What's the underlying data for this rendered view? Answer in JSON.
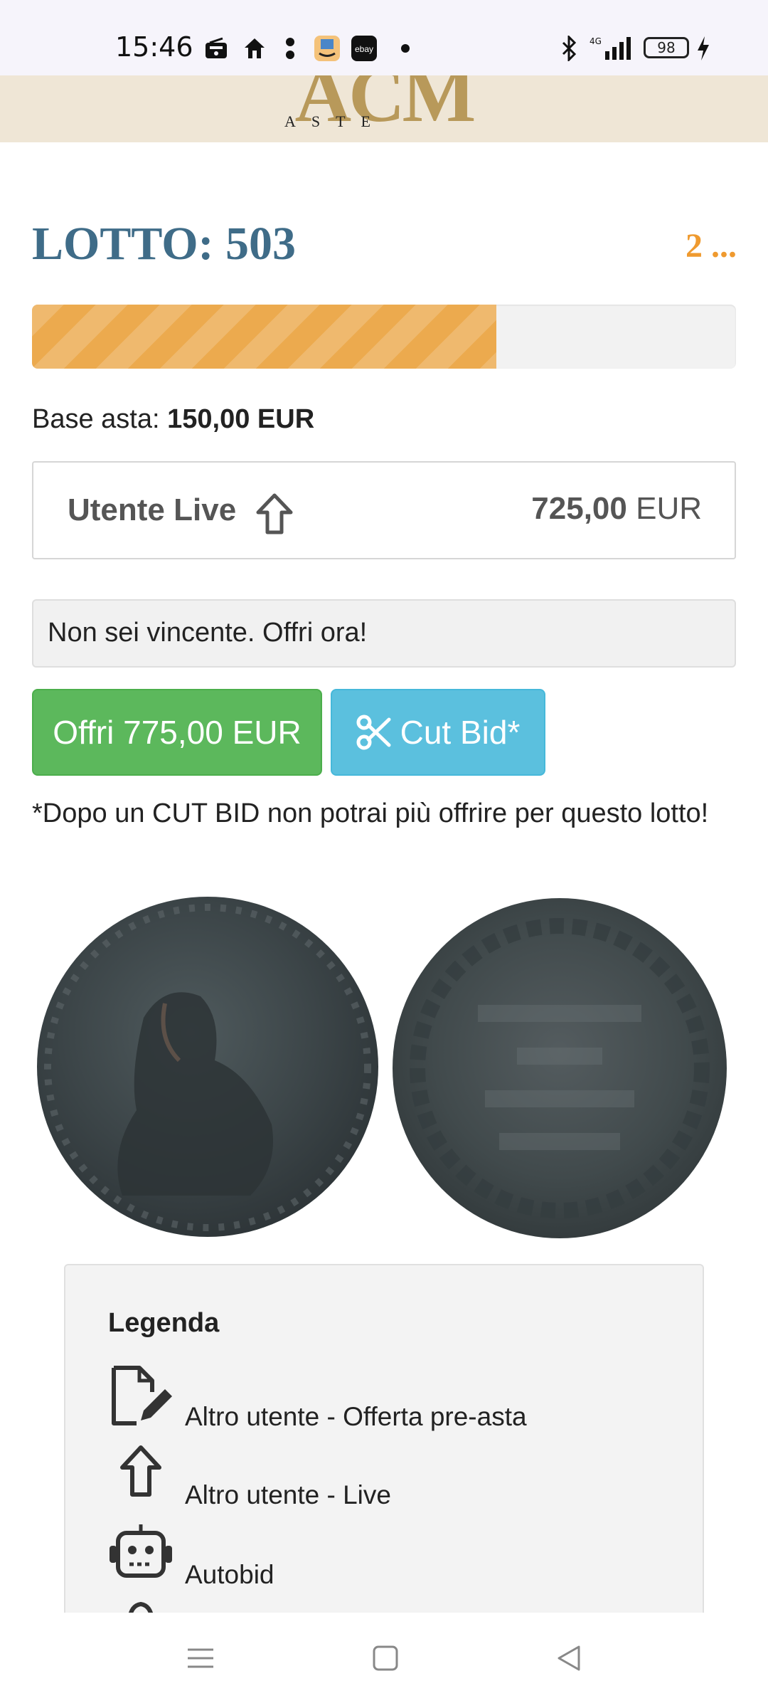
{
  "status_bar": {
    "time": "15:46",
    "battery": "98",
    "icons": [
      "radio-icon",
      "home-icon",
      "dots-icon",
      "amazon-icon",
      "ebay-icon",
      "dot-icon",
      "bluetooth-icon",
      "signal-4g-icon",
      "battery-icon",
      "charging-icon"
    ],
    "ebay_label": "ebay"
  },
  "header": {
    "logo_main": "ACM",
    "logo_sub": "ASTE"
  },
  "lot": {
    "title": "LOTTO: 503",
    "right_indicator": "2 ...",
    "progress_fraction": 0.66,
    "progress_color": "#ecaa4e"
  },
  "base_asta": {
    "label": "Base asta:",
    "value": "150,00 EUR"
  },
  "current_bid": {
    "user": "Utente Live",
    "user_icon": "arrow-up-icon",
    "amount": "725,00",
    "currency": "EUR"
  },
  "status_message": "Non sei vincente. Offri ora!",
  "buttons": {
    "offer_label": "Offri 775,00 EUR",
    "offer_color": "#5cb85c",
    "cut_label": "Cut Bid*",
    "cut_icon": "scissors-icon",
    "cut_color": "#5bc0de"
  },
  "note": "*Dopo un CUT BID non potrai più offrire per questo lotto!",
  "coin_images": {
    "obverse_icon": "coin-obverse-image",
    "reverse_icon": "coin-reverse-image"
  },
  "legend": {
    "title": "Legenda",
    "items": [
      {
        "icon": "file-edit-icon",
        "label": "Altro utente - Offerta pre-asta"
      },
      {
        "icon": "arrow-up-icon",
        "label": "Altro utente - Live"
      },
      {
        "icon": "robot-icon",
        "label": "Autobid"
      }
    ]
  },
  "nav": {
    "icons": [
      "menu-icon",
      "home-square-icon",
      "back-icon"
    ]
  }
}
